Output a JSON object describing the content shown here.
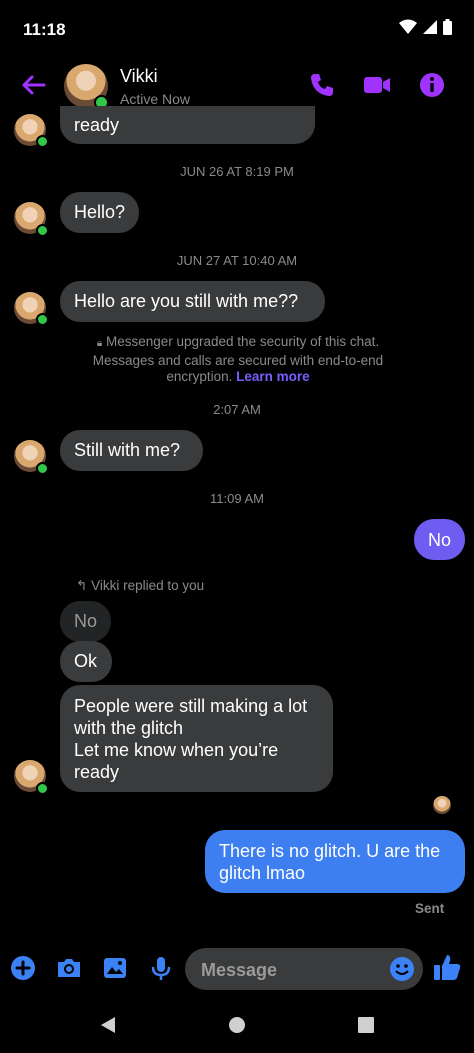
{
  "status_bar": {
    "time": "11:18"
  },
  "header": {
    "name": "Vikki",
    "status": "Active Now"
  },
  "messages": {
    "first_partial": "ready",
    "ts1": "JUN 26 AT 8:19 PM",
    "hello": "Hello?",
    "ts2": "JUN 27 AT 10:40 AM",
    "still_with_me_q": "Hello are you still with me??",
    "security_notice": "Messenger upgraded the security of this chat. Messages and calls are secured with end-to-end encryption.",
    "learn_more": "Learn more",
    "ts3": "2:07 AM",
    "still_with_me": "Still with me?",
    "ts4": "11:09 AM",
    "no_sent": "No",
    "reply_label": "Vikki replied to you",
    "quoted": "No",
    "ok": "Ok",
    "long_line1": "People were still making a lot",
    "long_line2": "with the glitch",
    "long_line3": "Let me know when you’re",
    "long_line4": "ready",
    "out_line1": "There is no glitch. U are the",
    "out_line2": "glitch lmao",
    "sent": "Sent"
  },
  "composer": {
    "placeholder": "Message"
  },
  "colors": {
    "accent": "#a033ff",
    "bubble_out": "#3d7ef0",
    "bubble_in": "#3a3b3c",
    "online": "#31c84a",
    "icons": "#3b82f6"
  }
}
